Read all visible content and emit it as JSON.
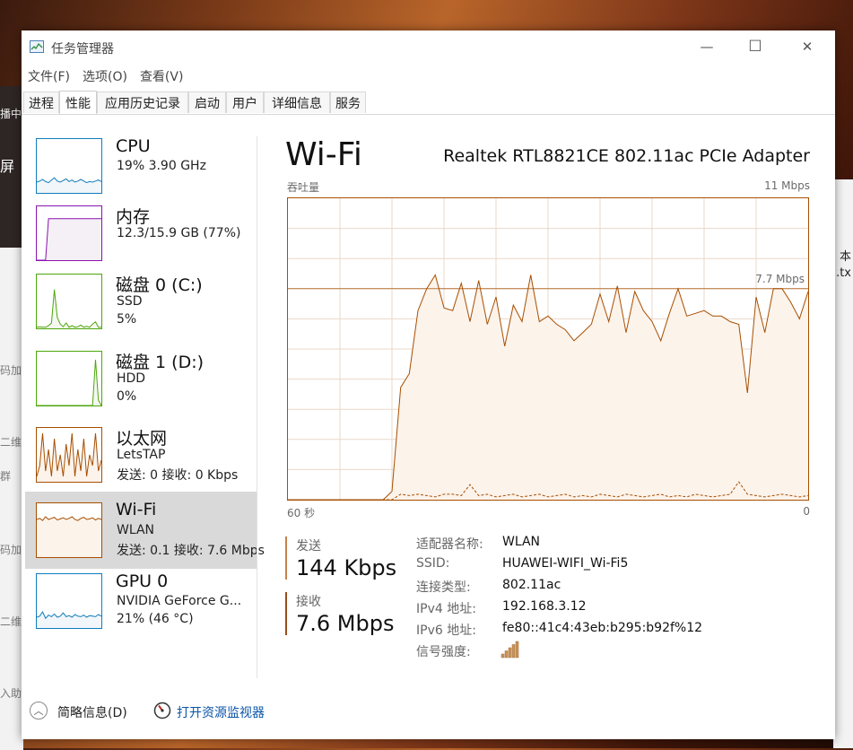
{
  "background": {
    "left_snippets": [
      "播中",
      "屏",
      "码加",
      "二维",
      "群",
      "码加",
      "二维",
      "入助"
    ],
    "right_snippets": [
      "本",
      ".tx"
    ]
  },
  "window": {
    "title": "任务管理器"
  },
  "window_controls": {
    "minimize": "—",
    "maximize": "☐",
    "close": "✕"
  },
  "menu": [
    "文件(F)",
    "选项(O)",
    "查看(V)"
  ],
  "tabs": [
    "进程",
    "性能",
    "应用历史记录",
    "启动",
    "用户",
    "详细信息",
    "服务"
  ],
  "active_tab": "性能",
  "sidebar": [
    {
      "name": "CPU",
      "line1": "19% 3.90 GHz",
      "line2": "",
      "color": "#117dbb",
      "fill": "#f1f6fa",
      "sparkline": [
        0.2,
        0.22,
        0.25,
        0.21,
        0.19,
        0.24,
        0.28,
        0.22,
        0.2,
        0.23,
        0.26,
        0.21,
        0.24,
        0.2,
        0.22,
        0.25,
        0.22,
        0.19,
        0.21,
        0.2,
        0.22,
        0.24,
        0.21
      ]
    },
    {
      "name": "内存",
      "line1": "12.3/15.9 GB (77%)",
      "line2": "",
      "color": "#8b12ae",
      "fill": "#f4f0f6",
      "sparkline": [
        0,
        0,
        0,
        0,
        0.77,
        0.77,
        0.77,
        0.77,
        0.77,
        0.77,
        0.77,
        0.77,
        0.77,
        0.77,
        0.77,
        0.77,
        0.77,
        0.77,
        0.77,
        0.77,
        0.77,
        0.77,
        0.77
      ]
    },
    {
      "name": "磁盘 0 (C:)",
      "line1": "SSD",
      "line2": "5%",
      "color": "#4da60c",
      "fill": "#f4f8f1",
      "sparkline": [
        0.02,
        0.03,
        0.02,
        0.02,
        0.05,
        0.1,
        0.72,
        0.2,
        0.08,
        0.03,
        0.1,
        0.02,
        0.05,
        0.02,
        0.03,
        0.06,
        0.02,
        0.04,
        0.02,
        0.08,
        0.12,
        0.02,
        0.02
      ]
    },
    {
      "name": "磁盘 1 (D:)",
      "line1": "HDD",
      "line2": "0%",
      "color": "#4da60c",
      "fill": "#f4f8f1",
      "sparkline": [
        0,
        0,
        0,
        0,
        0,
        0,
        0,
        0,
        0,
        0,
        0,
        0,
        0,
        0,
        0,
        0,
        0,
        0,
        0,
        0,
        0.85,
        0.1,
        0
      ]
    },
    {
      "name": "以太网",
      "line1": "LetsTAP",
      "line2": "发送: 0 接收: 0 Kbps",
      "color": "#a74f01",
      "fill": "#fcf3eb",
      "sparkline": [
        0.1,
        0.3,
        0.9,
        0.2,
        0.6,
        0.1,
        0.8,
        0.2,
        0.5,
        0.1,
        0.7,
        0.3,
        0.9,
        0.1,
        0.6,
        0.2,
        0.8,
        0.1,
        0.5,
        0.3,
        0.9,
        0.2,
        0.4
      ]
    },
    {
      "name": "Wi-Fi",
      "line1": "WLAN",
      "line2": "发送: 0.1 接收: 7.6 Mbps",
      "color": "#a74f01",
      "fill": "#fcf3eb",
      "sparkline": [
        0.7,
        0.72,
        0.68,
        0.75,
        0.7,
        0.72,
        0.74,
        0.69,
        0.71,
        0.73,
        0.7,
        0.72,
        0.75,
        0.7,
        0.68,
        0.72,
        0.74,
        0.7,
        0.71,
        0.73,
        0.69,
        0.72,
        0.7
      ]
    },
    {
      "name": "GPU 0",
      "line1": "NVIDIA GeForce G...",
      "line2": "21% (46 °C)",
      "color": "#117dbb",
      "fill": "#f1f6fa",
      "sparkline": [
        0.2,
        0.22,
        0.3,
        0.18,
        0.24,
        0.21,
        0.26,
        0.2,
        0.22,
        0.28,
        0.21,
        0.23,
        0.2,
        0.25,
        0.22,
        0.21,
        0.24,
        0.2,
        0.23,
        0.22,
        0.21,
        0.25,
        0.22
      ]
    }
  ],
  "selected_item": "Wi-Fi",
  "main": {
    "title": "Wi-Fi",
    "adapter": "Realtek RTL8821CE 802.11ac PCIe Adapter"
  },
  "chart_data": {
    "type": "line",
    "title": "",
    "ylabel": "吞吐量",
    "y_max_label": "11 Mbps",
    "x_left_label": "60 秒",
    "x_right_label": "0",
    "xlim": [
      60,
      0
    ],
    "ylim": [
      0,
      11
    ],
    "grid": true,
    "reference_line": {
      "value": 7.7,
      "label": "7.7 Mbps"
    },
    "series": [
      {
        "name": "接收",
        "x": [
          60,
          58,
          57,
          56,
          55,
          54,
          53,
          52,
          51,
          50,
          49,
          48,
          47,
          46,
          45,
          44,
          43,
          42,
          41,
          40,
          39,
          38,
          37,
          36,
          35,
          34,
          33,
          32,
          31,
          30,
          29,
          28,
          27,
          26,
          25,
          24,
          23,
          22,
          21,
          20,
          19,
          18,
          17,
          16,
          15,
          14,
          13,
          12,
          11,
          10,
          9,
          8,
          7,
          6,
          5,
          4,
          3,
          2,
          1,
          0
        ],
        "values": [
          0,
          0,
          0,
          0,
          0,
          0,
          0,
          0,
          0,
          0,
          0,
          0.3,
          4.1,
          4.6,
          6.9,
          7.7,
          8.2,
          7.0,
          6.9,
          7.9,
          6.5,
          8.0,
          6.4,
          7.4,
          5.6,
          7.1,
          6.5,
          8.2,
          6.5,
          6.7,
          6.4,
          6.2,
          5.8,
          6.1,
          6.4,
          7.5,
          6.5,
          7.8,
          6.1,
          7.6,
          6.9,
          6.5,
          5.8,
          6.8,
          7.7,
          6.7,
          6.8,
          6.9,
          6.7,
          6.7,
          6.5,
          6.4,
          3.9,
          7.4,
          6.1,
          7.7,
          7.7,
          7.2,
          6.6,
          7.6
        ]
      },
      {
        "name": "发送",
        "x": [
          60,
          58,
          57,
          56,
          55,
          54,
          53,
          52,
          51,
          50,
          49,
          48,
          47,
          46,
          45,
          44,
          43,
          42,
          41,
          40,
          39,
          38,
          37,
          36,
          35,
          34,
          33,
          32,
          31,
          30,
          29,
          28,
          27,
          26,
          25,
          24,
          23,
          22,
          21,
          20,
          19,
          18,
          17,
          16,
          15,
          14,
          13,
          12,
          11,
          10,
          9,
          8,
          7,
          6,
          5,
          4,
          3,
          2,
          1,
          0
        ],
        "values": [
          0,
          0,
          0,
          0,
          0,
          0,
          0,
          0,
          0,
          0,
          0,
          0,
          0.2,
          0.15,
          0.2,
          0.15,
          0.1,
          0.2,
          0.2,
          0.15,
          0.55,
          0.15,
          0.2,
          0.1,
          0.15,
          0.2,
          0.1,
          0.15,
          0.2,
          0.1,
          0.15,
          0.2,
          0.1,
          0.15,
          0.1,
          0.2,
          0.15,
          0.1,
          0.2,
          0.15,
          0.1,
          0.15,
          0.2,
          0.1,
          0.15,
          0.1,
          0.2,
          0.15,
          0.1,
          0.15,
          0.2,
          0.65,
          0.2,
          0.15,
          0.1,
          0.15,
          0.2,
          0.15,
          0.1,
          0.15
        ]
      }
    ],
    "colors": {
      "line": "#a74f01",
      "fill": "#fcf3eb",
      "grid": "#e9d8c9",
      "border": "#a74f01"
    }
  },
  "stats": {
    "send_label": "发送",
    "send_value": "144 Kbps",
    "recv_label": "接收",
    "recv_value": "7.6 Mbps"
  },
  "properties": [
    {
      "key": "适配器名称:",
      "value": "WLAN"
    },
    {
      "key": "SSID:",
      "value": "HUAWEI-WIFI_Wi-Fi5"
    },
    {
      "key": "连接类型:",
      "value": "802.11ac"
    },
    {
      "key": "IPv4 地址:",
      "value": "192.168.3.12"
    },
    {
      "key": "IPv6 地址:",
      "value": "fe80::41c4:43eb:b295:b92f%12"
    },
    {
      "key": "信号强度:",
      "value": ""
    }
  ],
  "signal_strength_bars": 5,
  "footer": {
    "fewer_details": "简略信息(D)",
    "resource_monitor": "打开资源监视器"
  }
}
